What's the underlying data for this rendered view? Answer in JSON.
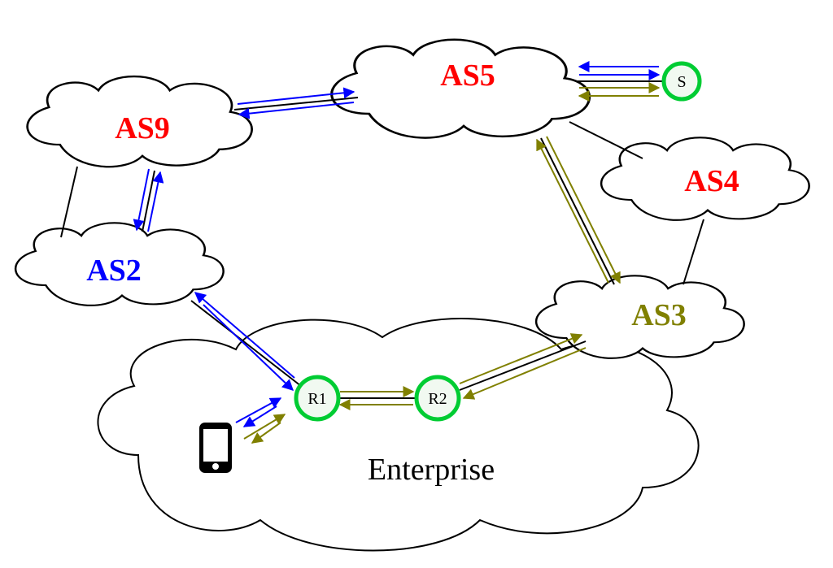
{
  "nodes": {
    "as9": {
      "label": "AS9",
      "color": "#ff0000"
    },
    "as2": {
      "label": "AS2",
      "color": "#0000ff"
    },
    "as5": {
      "label": "AS5",
      "color": "#ff0000"
    },
    "as4": {
      "label": "AS4",
      "color": "#ff0000"
    },
    "as3": {
      "label": "AS3",
      "color": "#808000"
    },
    "enterprise": {
      "label": "Enterprise",
      "color": "#000000"
    },
    "r1": {
      "label": "R1"
    },
    "r2": {
      "label": "R2"
    },
    "s": {
      "label": "S"
    }
  },
  "colors": {
    "cloud_stroke": "#000000",
    "node_ring": "#00cc33",
    "node_fill": "#f1f9f1",
    "path_blue": "#0000ff",
    "path_olive": "#808000",
    "link_black": "#000000"
  },
  "icon": {
    "phone": "phone-icon"
  }
}
